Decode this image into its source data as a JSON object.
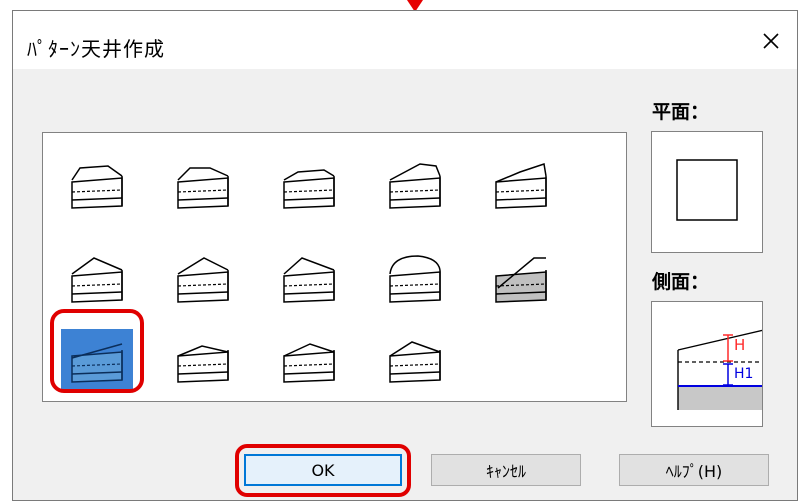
{
  "window": {
    "title": "ﾊﾟﾀｰﾝ天井作成",
    "close_glyph": "✕"
  },
  "patterns": {
    "count": 14,
    "selected_index": 10,
    "items": [
      {
        "icon": "hip-ceiling-icon"
      },
      {
        "icon": "hip-ceiling-variant-icon"
      },
      {
        "icon": "coffered-flat-ceiling-icon"
      },
      {
        "icon": "raised-slab-ceiling-icon"
      },
      {
        "icon": "stepped-shed-ceiling-icon"
      },
      {
        "icon": "gable-ceiling-icon"
      },
      {
        "icon": "pyramid-ceiling-icon"
      },
      {
        "icon": "gable-slope-ceiling-icon"
      },
      {
        "icon": "vault-ceiling-icon"
      },
      {
        "icon": "shaded-slope-ceiling-icon"
      },
      {
        "icon": "shed-ceiling-icon"
      },
      {
        "icon": "low-hip-ceiling-icon"
      },
      {
        "icon": "low-gable-ceiling-icon"
      },
      {
        "icon": "low-pyramid-ceiling-icon"
      }
    ]
  },
  "preview": {
    "plan_label": "平面：",
    "side_label": "側面：",
    "h_label": "H",
    "h1_label": "H1"
  },
  "buttons": {
    "ok": "OK",
    "cancel": "ｷｬﾝｾﾙ",
    "help": "ﾍﾙﾌﾟ(H)"
  },
  "colors": {
    "highlight_ring": "#e00000",
    "selection_fill": "#3d82d4",
    "ok_border": "#0078d7"
  }
}
